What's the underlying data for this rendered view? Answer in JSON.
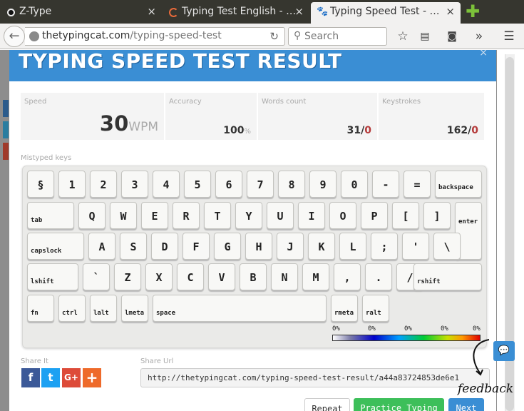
{
  "browser": {
    "tabs": [
      {
        "title": "Z-Type",
        "close": "×",
        "icon": "dot-icon",
        "active": false
      },
      {
        "title": "Typing Test English - …",
        "close": "×",
        "icon": "spinner-icon",
        "active": false
      },
      {
        "title": "Typing Speed Test - …",
        "close": "×",
        "icon": "paw-icon",
        "active": true
      }
    ],
    "new_tab": "✚",
    "url_domain": "thetypingcat.com",
    "url_path": "/typing-speed-test",
    "search_placeholder": "Search"
  },
  "modal": {
    "title": "TYPING SPEED TEST RESULT",
    "close": "×",
    "stats": {
      "speed_label": "Speed",
      "speed_value": "30",
      "speed_unit": "WPM",
      "accuracy_label": "Accuracy",
      "accuracy_value": "100",
      "accuracy_unit": "%",
      "words_label": "Words count",
      "words_value": "31/",
      "words_errors": "0",
      "keystrokes_label": "Keystrokes",
      "keystrokes_value": "162/",
      "keystrokes_errors": "0"
    },
    "mistyped_label": "Mistyped keys",
    "keyboard_rows": [
      [
        "§",
        "1",
        "2",
        "3",
        "4",
        "5",
        "6",
        "7",
        "8",
        "9",
        "0",
        "-",
        "=",
        "backspace"
      ],
      [
        "tab",
        "Q",
        "W",
        "E",
        "R",
        "T",
        "Y",
        "U",
        "I",
        "O",
        "P",
        "[",
        "]",
        "enter"
      ],
      [
        "capslock",
        "A",
        "S",
        "D",
        "F",
        "G",
        "H",
        "J",
        "K",
        "L",
        ";",
        "'",
        "\\"
      ],
      [
        "lshift",
        "`",
        "Z",
        "X",
        "C",
        "V",
        "B",
        "N",
        "M",
        ",",
        ".",
        "/",
        "rshift"
      ],
      [
        "fn",
        "ctrl",
        "lalt",
        "lmeta",
        "space",
        "rmeta",
        "ralt"
      ]
    ],
    "legend": [
      "0%",
      "0%",
      "0%",
      "0%",
      "0%"
    ],
    "share_label": "Share It",
    "share_buttons": [
      "f",
      "t",
      "G+",
      "+"
    ],
    "share_url_label": "Share Url",
    "share_url": "http://thetypingcat.com/typing-speed-test-result/a44a83724853de6e1",
    "buttons": {
      "repeat": "Repeat",
      "practice": "Practice Typing",
      "next": "Next"
    }
  },
  "feedback": {
    "label": "feedback"
  },
  "colors": {
    "accent": "#3a8ed4",
    "green": "#3dbf5a",
    "error": "#b53a3a"
  }
}
